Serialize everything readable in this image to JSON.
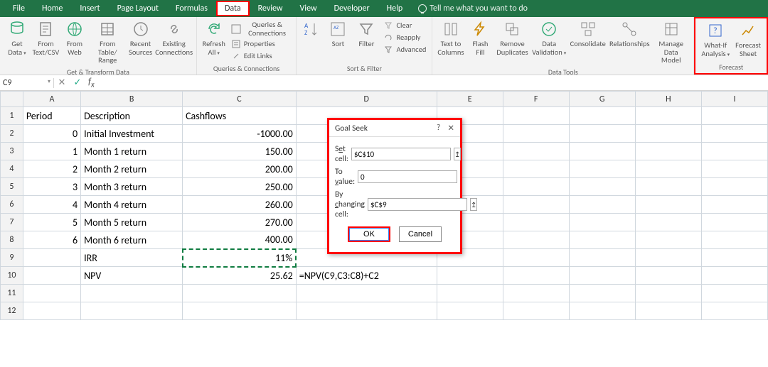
{
  "tabs": [
    "File",
    "Home",
    "Insert",
    "Page Layout",
    "Formulas",
    "Data",
    "Review",
    "View",
    "Developer",
    "Help"
  ],
  "tell_me": "Tell me what you want to do",
  "ribbon": {
    "get_transform": {
      "title": "Get & Transform Data",
      "btns": [
        "Get\nData",
        "From\nText/CSV",
        "From\nWeb",
        "From Table/\nRange",
        "Recent\nSources",
        "Existing\nConnections"
      ]
    },
    "queries": {
      "title": "Queries & Connections",
      "refresh": "Refresh\nAll",
      "items": [
        "Queries & Connections",
        "Properties",
        "Edit Links"
      ]
    },
    "sort": {
      "title": "Sort & Filter",
      "sort": "Sort",
      "filter": "Filter",
      "clear": "Clear",
      "reapply": "Reapply",
      "advanced": "Advanced"
    },
    "tools": {
      "title": "Data Tools",
      "btns": [
        "Text to\nColumns",
        "Flash\nFill",
        "Remove\nDuplicates",
        "Data\nValidation",
        "Consolidate",
        "Relationships",
        "Manage\nData Model"
      ]
    },
    "forecast": {
      "title": "Forecast",
      "whatif": "What-If\nAnalysis",
      "sheet": "Forecast\nSheet"
    }
  },
  "name_box": "C9",
  "columns": [
    "A",
    "B",
    "C",
    "D",
    "E",
    "F",
    "G",
    "H",
    "I"
  ],
  "rows": [
    1,
    2,
    3,
    4,
    5,
    6,
    7,
    8,
    9,
    10,
    11,
    12
  ],
  "data": {
    "headers": {
      "A": "Period",
      "B": "Description",
      "C": "Cashflows"
    },
    "records": [
      {
        "period": "0",
        "desc": "Initial Investment",
        "cash": "-1000.00"
      },
      {
        "period": "1",
        "desc": "Month 1 return",
        "cash": "150.00"
      },
      {
        "period": "2",
        "desc": "Month 2 return",
        "cash": "200.00"
      },
      {
        "period": "3",
        "desc": "Month 3 return",
        "cash": "250.00"
      },
      {
        "period": "4",
        "desc": "Month 4 return",
        "cash": "260.00"
      },
      {
        "period": "5",
        "desc": "Month 5 return",
        "cash": "270.00"
      },
      {
        "period": "6",
        "desc": "Month 6 return",
        "cash": "400.00"
      }
    ],
    "irr": {
      "label": "IRR",
      "value": "11%"
    },
    "npv": {
      "label": "NPV",
      "value": "25.62",
      "formula": "=NPV(C9,C3:C8)+C2"
    }
  },
  "goal_seek": {
    "title": "Goal Seek",
    "set_cell_label": "Set cell:",
    "set_cell": "$C$10",
    "to_value_label": "To value:",
    "to_value": "0",
    "by_cell_label": "By changing cell:",
    "by_cell": "$C$9",
    "ok": "OK",
    "cancel": "Cancel",
    "help": "?",
    "close": "✕"
  },
  "chart_data": {
    "type": "table",
    "title": "NPV / IRR worksheet",
    "columns": [
      "Period",
      "Description",
      "Cashflows"
    ],
    "rows": [
      [
        0,
        "Initial Investment",
        -1000.0
      ],
      [
        1,
        "Month 1 return",
        150.0
      ],
      [
        2,
        "Month 2 return",
        200.0
      ],
      [
        3,
        "Month 3 return",
        250.0
      ],
      [
        4,
        "Month 4 return",
        260.0
      ],
      [
        5,
        "Month 5 return",
        270.0
      ],
      [
        6,
        "Month 6 return",
        400.0
      ]
    ],
    "summary": {
      "IRR": 0.11,
      "NPV": 25.62,
      "NPV_formula": "=NPV(C9,C3:C8)+C2"
    }
  }
}
